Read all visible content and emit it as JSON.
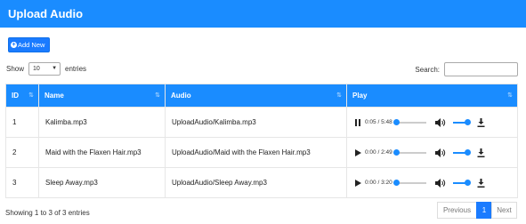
{
  "header": {
    "title": "Upload Audio"
  },
  "toolbar": {
    "add_label": "Add New"
  },
  "length_menu": {
    "show_label": "Show",
    "selected": "10",
    "entries_label": "entries"
  },
  "search": {
    "label": "Search:",
    "value": ""
  },
  "table": {
    "columns": [
      "ID",
      "Name",
      "Audio",
      "Play"
    ],
    "rows": [
      {
        "id": "1",
        "name": "Kalimba.mp3",
        "audio": "UploadAudio/Kalimba.mp3",
        "state": "playing",
        "time": "0:05 / 5:48",
        "progress": 0.014
      },
      {
        "id": "2",
        "name": "Maid with the Flaxen Hair.mp3",
        "audio": "UploadAudio/Maid with the Flaxen Hair.mp3",
        "state": "paused",
        "time": "0:00 / 2:49",
        "progress": 0
      },
      {
        "id": "3",
        "name": "Sleep Away.mp3",
        "audio": "UploadAudio/Sleep Away.mp3",
        "state": "paused",
        "time": "0:00 / 3:20",
        "progress": 0
      }
    ]
  },
  "footer": {
    "info": "Showing 1 to 3 of 3 entries",
    "previous": "Previous",
    "current_page": "1",
    "next": "Next"
  },
  "colors": {
    "accent": "#1a8cff",
    "button": "#1a7bff"
  }
}
